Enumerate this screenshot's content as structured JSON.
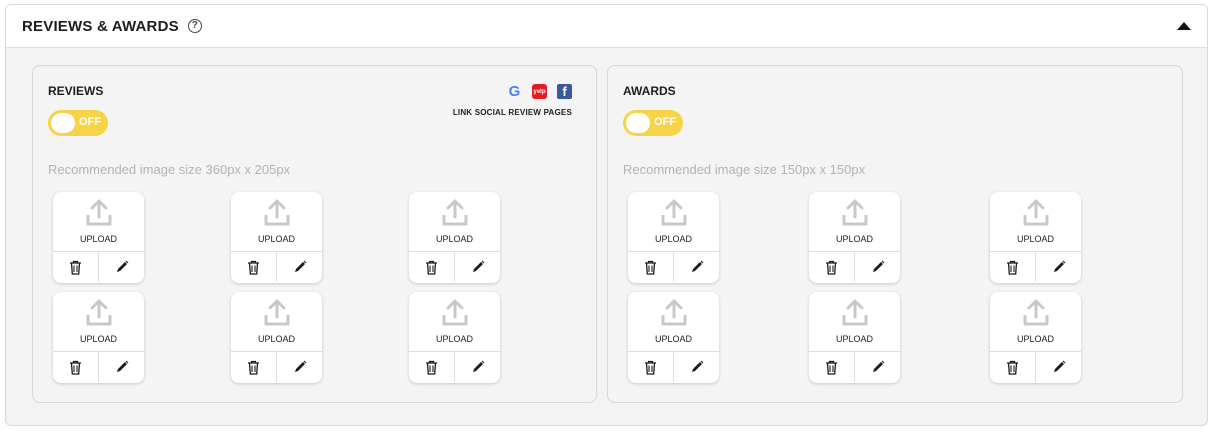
{
  "section": {
    "title": "REVIEWS & AWARDS",
    "help_icon": "question-circle-icon",
    "collapse_icon": "caret-up-icon"
  },
  "reviews": {
    "label": "REVIEWS",
    "toggle": "OFF",
    "hint": "Recommended image size 360px x 205px",
    "social": {
      "icons": [
        "google-icon",
        "yelp-icon",
        "facebook-icon"
      ],
      "link": "LINK SOCIAL REVIEW PAGES"
    },
    "tiles": [
      {
        "upload": "UPLOAD"
      },
      {
        "upload": "UPLOAD"
      },
      {
        "upload": "UPLOAD"
      },
      {
        "upload": "UPLOAD"
      },
      {
        "upload": "UPLOAD"
      },
      {
        "upload": "UPLOAD"
      }
    ]
  },
  "awards": {
    "label": "AWARDS",
    "toggle": "OFF",
    "hint": "Recommended image size 150px x 150px",
    "tiles": [
      {
        "upload": "UPLOAD"
      },
      {
        "upload": "UPLOAD"
      },
      {
        "upload": "UPLOAD"
      },
      {
        "upload": "UPLOAD"
      },
      {
        "upload": "UPLOAD"
      },
      {
        "upload": "UPLOAD"
      }
    ]
  },
  "colors": {
    "toggle_bg": "#f7d447",
    "hint_text": "#b3b3b3",
    "icon_gray": "#c8c8c8"
  }
}
